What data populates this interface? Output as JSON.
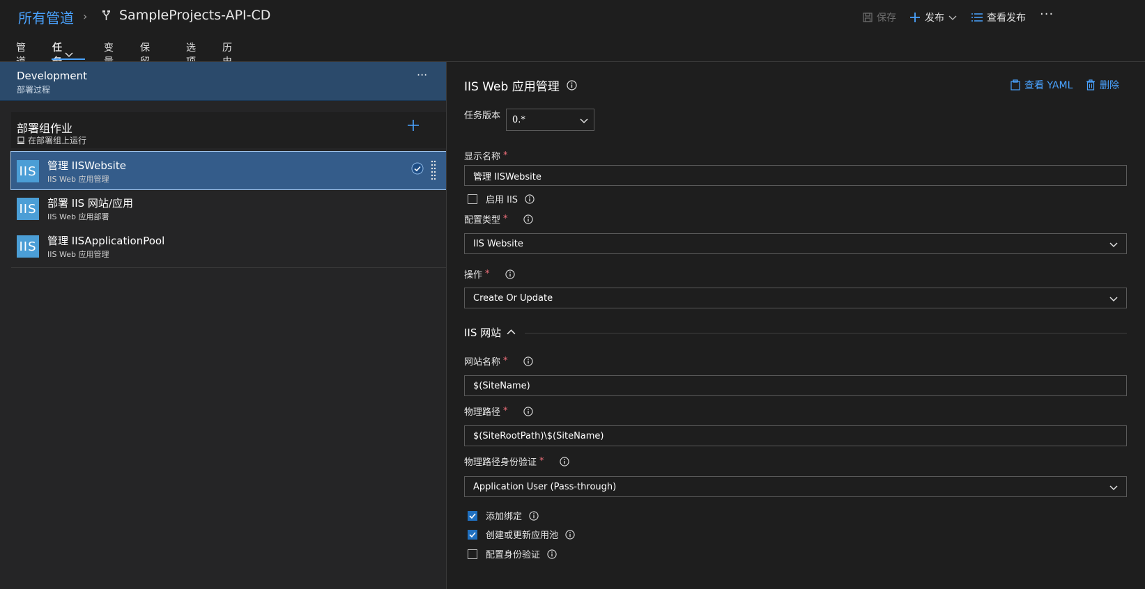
{
  "header": {
    "breadcrumb_root": "所有管道",
    "breadcrumb_sep": "›",
    "pipeline_title": "SampleProjects-API-CD",
    "save_label": "保存",
    "release_label": "发布",
    "view_releases_label": "查看发布",
    "more_label": "···"
  },
  "tabs": [
    {
      "label": "管道"
    },
    {
      "label": "任务"
    },
    {
      "label": "变量"
    },
    {
      "label": "保留期"
    },
    {
      "label": "选项"
    },
    {
      "label": "历史记录"
    }
  ],
  "stage": {
    "name": "Development",
    "subtitle": "部署过程",
    "more": "···"
  },
  "job": {
    "name": "部署组作业",
    "subtitle": "在部署组上运行"
  },
  "tasks": [
    {
      "badge": "IIS",
      "title": "管理 IISWebsite",
      "subtitle": "IIS Web 应用管理",
      "selected": true
    },
    {
      "badge": "IIS",
      "title": "部署 IIS 网站/应用",
      "subtitle": "IIS Web 应用部署"
    },
    {
      "badge": "IIS",
      "title": "管理 IISApplicationPool",
      "subtitle": "IIS Web 应用管理"
    }
  ],
  "panel": {
    "title": "IIS Web 应用管理",
    "view_yaml": "查看 YAML",
    "delete": "删除",
    "version_label": "任务版本",
    "version_value": "0.*",
    "display_name_label": "显示名称",
    "display_name_value": "管理 IISWebsite",
    "enable_iis_label": "启用 IIS",
    "enable_iis_checked": false,
    "config_type_label": "配置类型",
    "config_type_value": "IIS Website",
    "action_label": "操作",
    "action_value": "Create Or Update",
    "section_title": "IIS 网站",
    "site_name_label": "网站名称",
    "site_name_value": "$(SiteName)",
    "physical_path_label": "物理路径",
    "physical_path_value": "$(SiteRootPath)\\$(SiteName)",
    "auth_label": "物理路径身份验证",
    "auth_value": "Application User (Pass-through)",
    "add_binding_label": "添加绑定",
    "add_binding_checked": true,
    "create_pool_label": "创建或更新应用池",
    "create_pool_checked": true,
    "configure_auth_label": "配置身份验证",
    "configure_auth_checked": false,
    "required_mark": "*"
  },
  "colors": {
    "accent": "#4aa3ff",
    "stage_bg": "#2b4a6b",
    "selected_bg": "#345c8a",
    "badge_bg": "#4b9ed6",
    "required": "#f1707b"
  }
}
